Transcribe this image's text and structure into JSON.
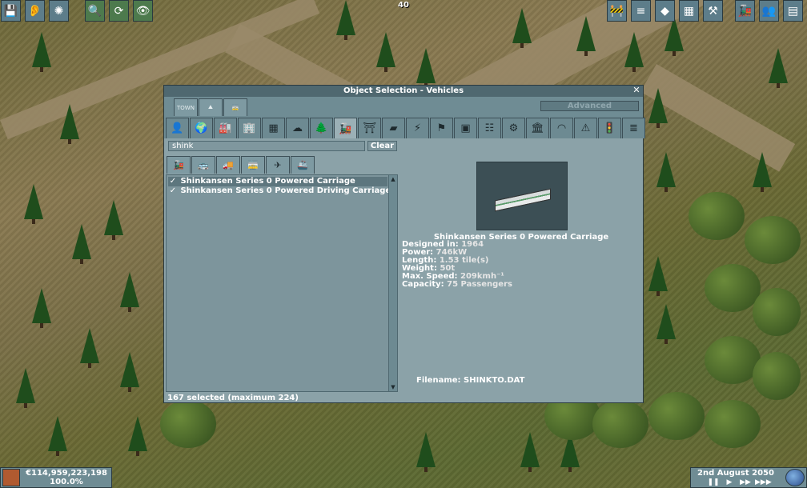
{
  "toolbar": {
    "left_icons": [
      "save-icon",
      "audio-icon",
      "options-icon",
      "zoom-icon",
      "rotate-icon",
      "view-icon"
    ],
    "right_icons": [
      "railroad-icon",
      "road-icon",
      "terraform-icon",
      "station-icon",
      "build-icon",
      "vehicles-icon",
      "people-icon",
      "stats-icon"
    ],
    "game_speed": "40"
  },
  "window": {
    "title": "Object Selection - Vehicles",
    "close_label": "✕",
    "primary_tabs": [
      {
        "label": "TOWN",
        "icon": "town-icon"
      },
      {
        "label": "",
        "icon": "terrain-icon"
      },
      {
        "label": "",
        "icon": "vehicles-tab-icon"
      }
    ],
    "advanced_label": "Advanced",
    "category_tabs": [
      "person-icon",
      "globe-icon",
      "industry-icon",
      "building-icon",
      "wall-icon",
      "weather-icon",
      "trees-icon",
      "train-icon",
      "signal-icon",
      "track-icon",
      "bridge-icon",
      "road-station-icon",
      "cargo-icon",
      "rails-icon",
      "gear-icon",
      "depot-icon",
      "tunnel-icon",
      "crossing-icon",
      "traffic-lights-icon",
      "road-icon"
    ],
    "active_category_index": 7,
    "search": {
      "value": "shink",
      "placeholder": ""
    },
    "clear_label": "Clear",
    "filter_tabs": [
      "steam-icon",
      "bus-icon",
      "truck-icon",
      "tram-icon",
      "aircraft-icon",
      "ship-icon"
    ],
    "items": [
      {
        "checked": true,
        "label": "Shinkansen Series 0 Powered Carriage",
        "selected": true
      },
      {
        "checked": true,
        "label": "Shinkansen Series 0 Powered Driving Carriage",
        "selected": false
      }
    ],
    "selection_status": "167 selected (maximum 224)",
    "details": {
      "name": "Shinkansen Series 0 Powered Carriage",
      "stats": [
        {
          "label": "Designed in:",
          "value": "1964"
        },
        {
          "label": "Power:",
          "value": "746kW"
        },
        {
          "label": "Length:",
          "value": "1.53 tile(s)"
        },
        {
          "label": "Weight:",
          "value": "50t"
        },
        {
          "label": "Max. Speed:",
          "value": "209kmh⁻¹"
        },
        {
          "label": "Capacity:",
          "value": "75 Passengers"
        }
      ],
      "filename_label": "Filename:",
      "filename": "SHINKTO.DAT"
    }
  },
  "status_bar": {
    "money": "€114,959,223,198",
    "performance": "100.0%",
    "date": "2nd August 2050",
    "speed_buttons": [
      "❚❚",
      "▶",
      "▶▶",
      "▶▶▶"
    ]
  }
}
